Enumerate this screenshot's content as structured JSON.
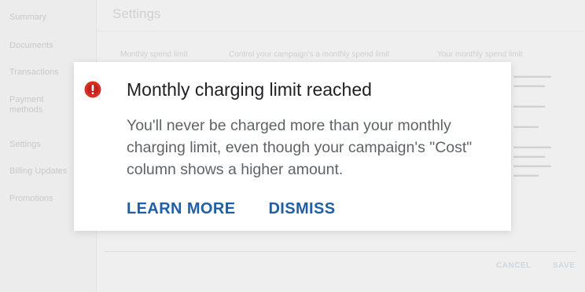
{
  "sidebar": {
    "items": [
      {
        "label": "Summary"
      },
      {
        "label": "Documents"
      },
      {
        "label": "Transactions"
      },
      {
        "label": "Payment\nmethods"
      },
      {
        "label": "Settings"
      },
      {
        "label": "Billing Updates"
      },
      {
        "label": "Promotions"
      }
    ]
  },
  "main": {
    "title": "Settings",
    "row_label": "Monthly spend limit",
    "row_text": "Control your campaign's a monthly spend limit",
    "row_right": "Your monthly spend limit",
    "cancel_label": "CANCEL",
    "save_label": "SAVE"
  },
  "dialog": {
    "icon": "alert-circle-icon",
    "icon_color": "#d93025",
    "title": "Monthly charging limit reached",
    "body": "You'll never be charged more than your monthly charging limit, even though your campaign's \"Cost\" column shows a higher amount.",
    "actions": {
      "learn_more": "LEARN MORE",
      "dismiss": "DISMISS"
    },
    "accent_color": "#1f5fa6"
  }
}
